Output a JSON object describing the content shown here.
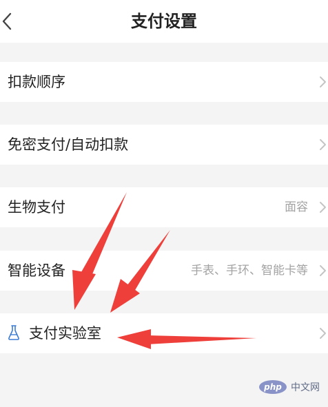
{
  "header": {
    "title": "支付设置",
    "back_icon": "chevron-left-icon"
  },
  "rows": [
    {
      "label": "扣款顺序",
      "value": ""
    },
    {
      "label": "免密支付/自动扣款",
      "value": ""
    },
    {
      "label": "生物支付",
      "value": "面容"
    },
    {
      "label": "智能设备",
      "value": "手表、手环、智能卡等"
    },
    {
      "label": "支付实验室",
      "value": "",
      "icon": "flask-icon"
    }
  ],
  "annotation": {
    "arrow_color": "#ee3f3a"
  },
  "watermark": {
    "logo": "php",
    "text": "中文网"
  }
}
